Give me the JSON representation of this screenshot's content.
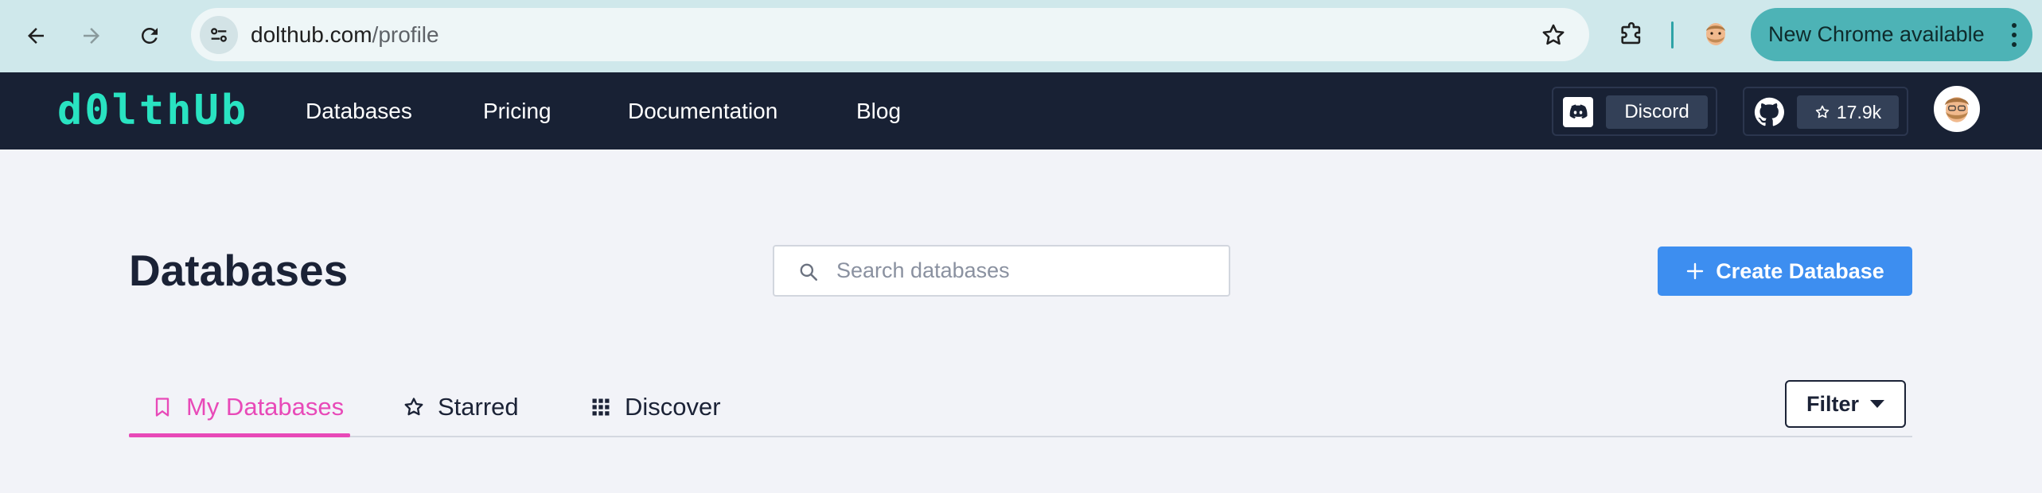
{
  "browser": {
    "url_host": "dolthub.com",
    "url_path": "/profile",
    "update_label": "New Chrome available",
    "icons": [
      "back-arrow-icon",
      "forward-arrow-icon",
      "reload-icon",
      "site-settings-icon",
      "bookmark-star-icon",
      "extensions-icon",
      "profile-avatar-icon",
      "more-menu-icon"
    ]
  },
  "navbar": {
    "logo": "d0lthUb",
    "links": [
      "Databases",
      "Pricing",
      "Documentation",
      "Blog"
    ],
    "discord_label": "Discord",
    "github_stars": "17.9k",
    "icons": [
      "discord-icon",
      "github-icon",
      "star-icon",
      "user-avatar-icon"
    ]
  },
  "main": {
    "title": "Databases",
    "search_placeholder": "Search databases",
    "create_label": "Create Database",
    "tabs": [
      {
        "label": "My Databases",
        "icon": "bookmark-icon",
        "active": true
      },
      {
        "label": "Starred",
        "icon": "star-icon",
        "active": false
      },
      {
        "label": "Discover",
        "icon": "grid-icon",
        "active": false
      }
    ],
    "filter_label": "Filter"
  },
  "colors": {
    "chrome_bg": "#cfe8eb",
    "navbar_bg": "#182134",
    "logo": "#29e3c1",
    "accent_pink": "#e849b8",
    "primary_blue": "#3d8ef0",
    "page_bg": "#f2f3f8"
  }
}
